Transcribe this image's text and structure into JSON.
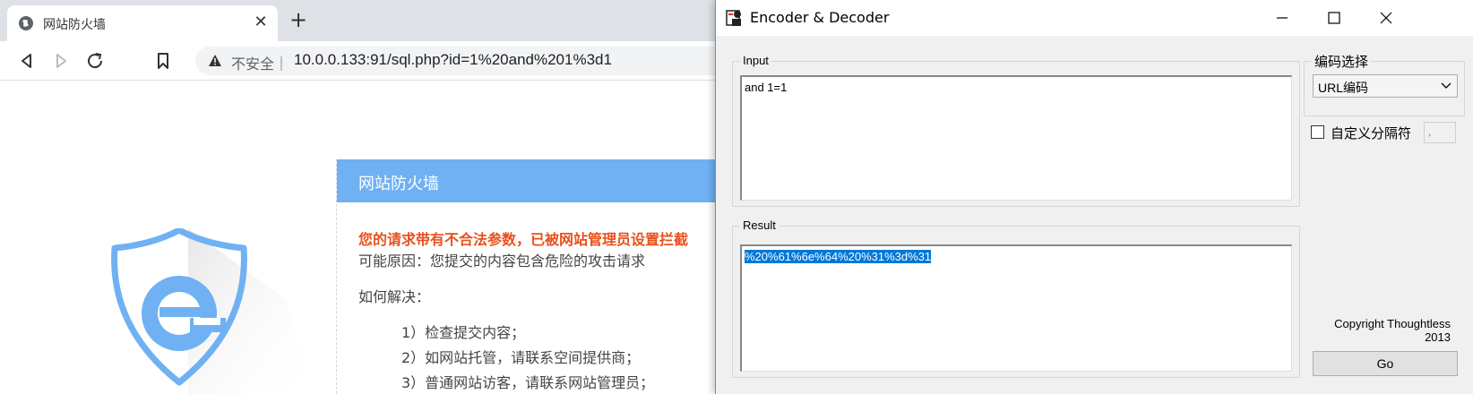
{
  "browser": {
    "tab_title": "网站防火墙",
    "tab_close": "✕",
    "new_tab": "+",
    "not_secure": "不安全｜",
    "url": "10.0.0.133:91/sql.php?id=1%20and%201%3d1"
  },
  "firewall": {
    "header": "网站防火墙",
    "warning": "您的请求带有不合法参数，已被网站管理员设置拦截",
    "reason": "可能原因：您提交的内容包含危险的攻击请求",
    "howto": "如何解决：",
    "steps": [
      "1）检查提交内容；",
      "2）如网站托管，请联系空间提供商；",
      "3）普通网站访客，请联系网站管理员；"
    ]
  },
  "encoder": {
    "title": "Encoder & Decoder",
    "input_label": "Input",
    "input_value": "and 1=1",
    "result_label": "Result",
    "result_value": "%20%61%6e%64%20%31%3d%31",
    "encoding_group_label": "编码选择",
    "encoding_selected": "URL编码",
    "custom_separator_label": "自定义分隔符",
    "separator_value": ",",
    "copyright_line1": "Copyright Thoughtless",
    "copyright_line2": "2013",
    "go_label": "Go"
  },
  "colors": {
    "firewall_header": "#6fb1f3",
    "warning_text": "#e8501c",
    "selection": "#0078d7"
  }
}
